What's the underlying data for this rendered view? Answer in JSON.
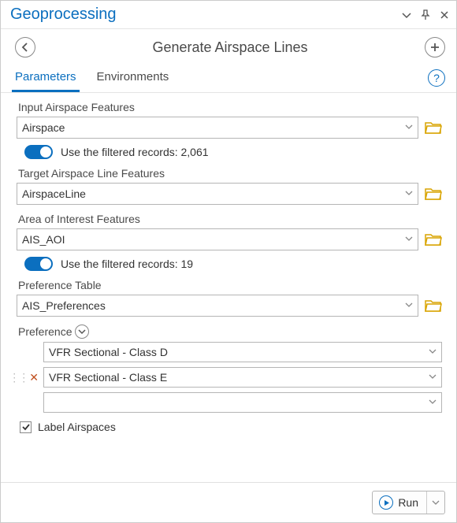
{
  "pane": {
    "title": "Geoprocessing"
  },
  "tool": {
    "title": "Generate Airspace Lines"
  },
  "tabs": {
    "parameters": "Parameters",
    "environments": "Environments"
  },
  "params": {
    "input_airspace": {
      "label": "Input Airspace Features",
      "value": "Airspace",
      "filtered_text": "Use the filtered records: 2,061",
      "toggle_on": true
    },
    "target_line": {
      "label": "Target Airspace Line Features",
      "value": "AirspaceLine"
    },
    "aoi": {
      "label": "Area of Interest Features",
      "value": "AIS_AOI",
      "filtered_text": "Use the filtered records: 19",
      "toggle_on": true
    },
    "pref_table": {
      "label": "Preference Table",
      "value": "AIS_Preferences"
    },
    "preference": {
      "label": "Preference",
      "rows": [
        "VFR Sectional - Class D",
        "VFR Sectional - Class E",
        ""
      ]
    },
    "label_airspaces": {
      "label": "Label Airspaces",
      "checked": true
    }
  },
  "footer": {
    "run": "Run"
  }
}
